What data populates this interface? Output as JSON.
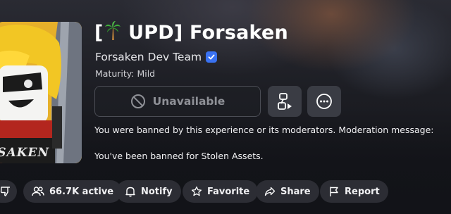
{
  "experience": {
    "title_prefix": "[",
    "title_icon": "palm-tree",
    "title_suffix": " UPD] Forsaken",
    "creator": "Forsaken Dev Team",
    "creator_verified": true,
    "maturity": "Maturity: Mild",
    "thumbnail_text": "SAKEN"
  },
  "play_button": {
    "label": "Unavailable",
    "icon": "ban-icon"
  },
  "icon_buttons": [
    {
      "name": "avatar-switch-button",
      "icon": "shapes-play-icon"
    },
    {
      "name": "more-options-button",
      "icon": "ellipsis-icon"
    }
  ],
  "ban": {
    "message": "You were banned by this experience or its moderators. Moderation message:",
    "reason": "You've been banned for Stolen Assets."
  },
  "actions": {
    "dislike_icon": "thumbs-down-icon",
    "active": "66.7K active",
    "notify": "Notify",
    "favorite": "Favorite",
    "share": "Share",
    "report": "Report"
  },
  "colors": {
    "background": "#1a1b21",
    "chip": "#2c2d34",
    "verified": "#3a72f2",
    "thumbnail_yellow": "#e9b52c"
  }
}
